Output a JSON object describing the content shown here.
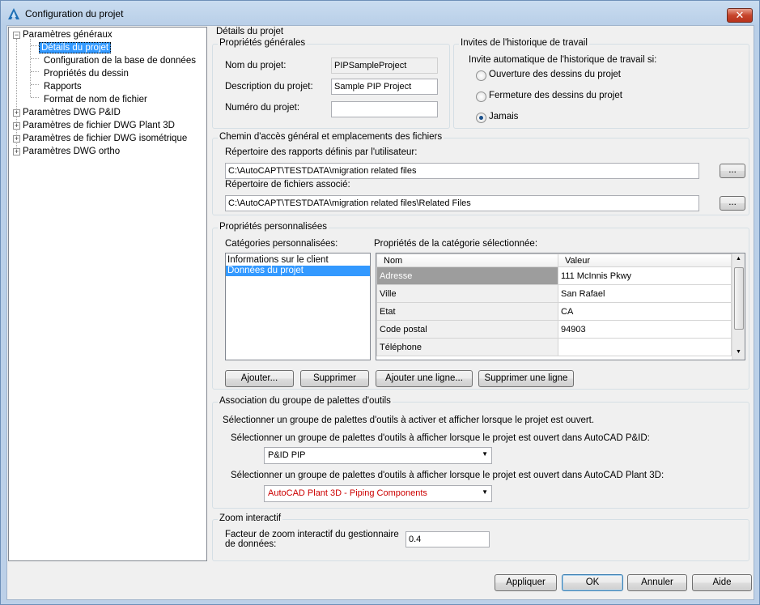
{
  "window": {
    "title": "Configuration du projet",
    "close_glyph": "✕"
  },
  "tree": {
    "root1": "Paramètres généraux",
    "child_selected": "Détails du projet",
    "children": [
      "Configuration de la base de données",
      "Propriétés du dessin",
      "Rapports",
      "Format de nom de fichier"
    ],
    "others": [
      "Paramètres DWG P&ID",
      "Paramètres de fichier DWG Plant 3D",
      "Paramètres de fichier DWG isométrique",
      "Paramètres DWG ortho"
    ]
  },
  "page": {
    "heading": "Détails du projet"
  },
  "general": {
    "title": "Propriétés générales",
    "name_label": "Nom du projet:",
    "name_value": "PIPSampleProject",
    "desc_label": "Description du projet:",
    "desc_value": "Sample PIP Project",
    "num_label": "Numéro du projet:",
    "num_value": ""
  },
  "history": {
    "title": "Invites de l'historique de travail",
    "prompt": "Invite automatique de l'historique de travail si:",
    "options": [
      "Ouverture des dessins du projet",
      "Fermeture des dessins du projet",
      "Jamais"
    ],
    "selected": "Jamais"
  },
  "paths": {
    "title": "Chemin d'accès général et emplacements des fichiers",
    "reports_label": "Répertoire des rapports définis par l'utilisateur:",
    "reports_value": "C:\\AutoCAPT\\TESTDATA\\migration related files",
    "related_label": "Répertoire de fichiers associé:",
    "related_value": "C:\\AutoCAPT\\TESTDATA\\migration related files\\Related Files",
    "browse": "..."
  },
  "custom": {
    "title": "Propriétés personnalisées",
    "categories_label": "Catégories personnalisées:",
    "categories": [
      "Informations sur le client",
      "Données du projet"
    ],
    "selected_category": "Données du projet",
    "props_label": "Propriétés de la catégorie sélectionnée:",
    "columns": [
      "Nom",
      "Valeur"
    ],
    "rows": [
      [
        "Adresse",
        "111 McInnis Pkwy"
      ],
      [
        "Ville",
        "San Rafael"
      ],
      [
        "Etat",
        "CA"
      ],
      [
        "Code postal",
        "94903"
      ],
      [
        "Téléphone",
        ""
      ]
    ],
    "buttons": [
      "Ajouter...",
      "Supprimer",
      "Ajouter une ligne...",
      "Supprimer une ligne"
    ]
  },
  "palettes": {
    "title": "Association du groupe de palettes d'outils",
    "intro": "Sélectionner un groupe de palettes d'outils à activer et afficher lorsque le projet est ouvert.",
    "pid_label": "Sélectionner un groupe de palettes d'outils à afficher lorsque le projet est ouvert dans AutoCAD P&ID:",
    "pid_value": "P&ID PIP",
    "plant_label": "Sélectionner un groupe de palettes d'outils à afficher lorsque le projet est ouvert dans AutoCAD Plant 3D:",
    "plant_value": "AutoCAD Plant 3D - Piping Components",
    "plant_color": "#cc0000"
  },
  "zoom": {
    "title": "Zoom interactif",
    "label_line1": "Facteur de zoom interactif du gestionnaire",
    "label_line2": "de données:",
    "value": "0.4"
  },
  "footer": {
    "apply": "Appliquer",
    "ok": "OK",
    "cancel": "Annuler",
    "help": "Aide"
  }
}
